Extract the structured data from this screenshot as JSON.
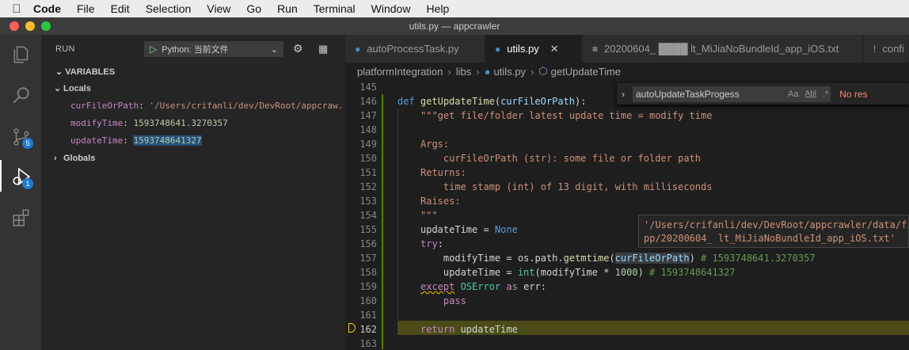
{
  "menubar": {
    "items": [
      "Code",
      "File",
      "Edit",
      "Selection",
      "View",
      "Go",
      "Run",
      "Terminal",
      "Window",
      "Help"
    ]
  },
  "window": {
    "title": "utils.py — appcrawler"
  },
  "activity_bar": {
    "badges": {
      "source_control": "5",
      "run": "1"
    }
  },
  "sidebar": {
    "run_label": "RUN",
    "config_select": "Python: 当前文件",
    "variables_header": "VARIABLES",
    "locals_label": "Locals",
    "globals_label": "Globals",
    "locals": [
      {
        "name": "curFileOrPath",
        "value": "'/Users/crifanli/dev/DevRoot/appcraw..."
      },
      {
        "name": "modifyTime",
        "value": "1593748641.3270357"
      },
      {
        "name": "updateTime",
        "value": "1593748641327"
      }
    ]
  },
  "tabs": [
    {
      "label": "autoProcessTask.py",
      "active": false
    },
    {
      "label": "utils.py",
      "active": true
    },
    {
      "label": "20200604_ ████ lt_MiJiaNoBundleId_app_iOS.txt",
      "active": false
    },
    {
      "label": "confi",
      "active": false
    }
  ],
  "breadcrumb": [
    "platformIntegration",
    "libs",
    "utils.py",
    "getUpdateTime"
  ],
  "find": {
    "value": "autoUpdateTaskProgess",
    "opt_case": "Aa",
    "opt_word": "Abl",
    "opt_regex": ".*",
    "result": "No res"
  },
  "hover": {
    "line1": "'/Users/crifanli/dev/DevRoot/appcrawler/data/fi",
    "line2": "pp/20200604_     lt_MiJiaNoBundleId_app_iOS.txt'"
  },
  "editor": {
    "line_numbers": [
      "145",
      "146",
      "147",
      "148",
      "149",
      "150",
      "151",
      "152",
      "153",
      "154",
      "155",
      "156",
      "157",
      "158",
      "159",
      "160",
      "161",
      "162",
      "163"
    ],
    "current_line": "162",
    "code": {
      "l146_kw": "def",
      "l146_fn": "getUpdateTime",
      "l146_rest": "(",
      "l146_param": "curFileOrPath",
      "l146_end": "):",
      "l147": "\"\"\"get file/folder latest update time = modify time",
      "l149": "Args:",
      "l150": "    curFileOrPath (str): some file or folder path",
      "l151": "Returns:",
      "l152": "    time stamp (int) of 13 digit, with milliseconds",
      "l153": "Raises:",
      "l154": "\"\"\"",
      "l155_a": "updateTime = ",
      "l155_b": "None",
      "l156_kw": "try",
      "l156_rest": ":",
      "l157_a": "    modifyTime = os.path.",
      "l157_fn": "getmtime",
      "l157_b": "(",
      "l157_param": "curFileOrPath",
      "l157_c": ") ",
      "l157_cm": "# 1593748641.3270357",
      "l158_a": "    updateTime = ",
      "l158_fn": "int",
      "l158_b": "(modifyTime * ",
      "l158_num": "1000",
      "l158_c": ") ",
      "l158_cm": "# 1593748641327",
      "l159_kw": "except",
      "l159_cls": "OSError",
      "l159_kw2": "as",
      "l159_rest": " err:",
      "l160": "    pass",
      "l162_kw": "return",
      "l162_rest": " updateTime"
    }
  },
  "colors": {
    "accent": "#007acc",
    "debug_line": "#4b4b18",
    "badge": "#1f7ad2"
  }
}
